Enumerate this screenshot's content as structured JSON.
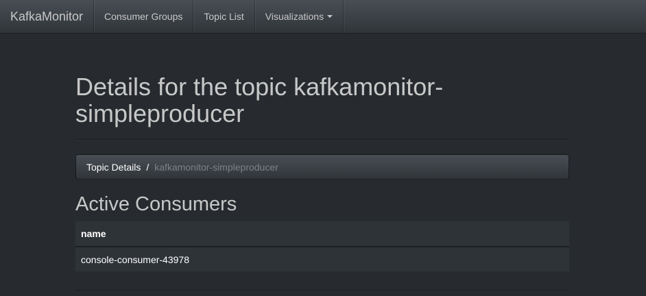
{
  "navbar": {
    "brand": "KafkaMonitor",
    "items": [
      {
        "label": "Consumer Groups"
      },
      {
        "label": "Topic List"
      },
      {
        "label": "Visualizations"
      }
    ]
  },
  "page": {
    "title": "Details for the topic kafkamonitor-simpleproducer"
  },
  "breadcrumb": {
    "link": "Topic Details",
    "separator": "/",
    "active": "kafkamonitor-simpleproducer"
  },
  "consumers": {
    "title": "Active Consumers",
    "columns": [
      "name"
    ],
    "rows": [
      [
        "console-consumer-43978"
      ]
    ]
  },
  "colors": {
    "background": "#272b30",
    "navbar": "#3a3f44",
    "table_bg": "#2e3338",
    "text": "#c8c8c8",
    "muted": "#7a8288"
  },
  "icons": {
    "dropdown": "caret-down-icon"
  }
}
